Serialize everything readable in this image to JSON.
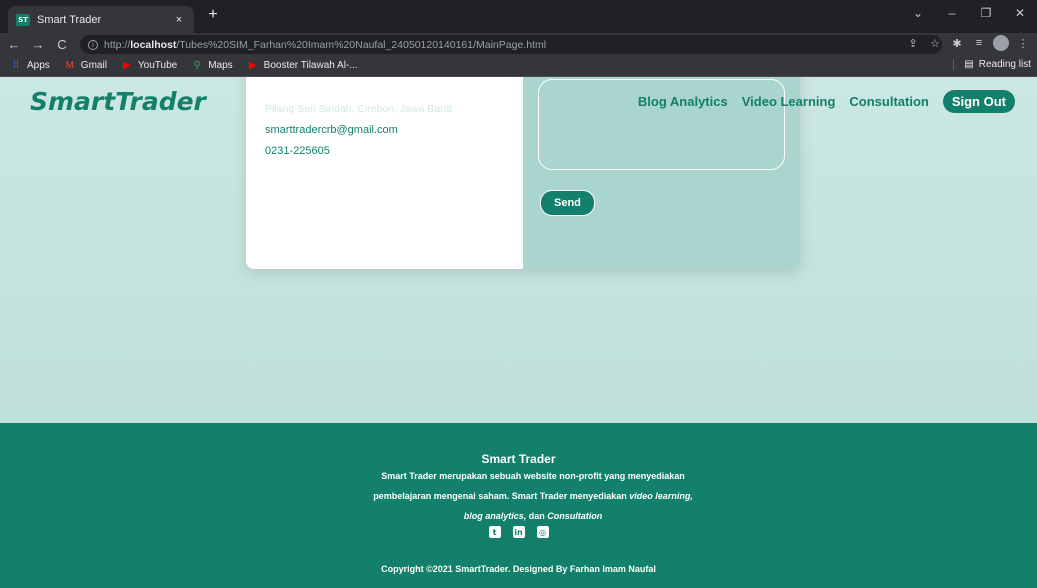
{
  "browser": {
    "tab": {
      "favicon": "ST",
      "title": "Smart Trader",
      "close": "×"
    },
    "new_tab": "+",
    "window_controls": [
      "⌄",
      "–",
      "❐",
      "✕"
    ],
    "nav_buttons": [
      "←",
      "→",
      "C"
    ],
    "url": {
      "prefix": "http://",
      "host": "localhost",
      "path": "/Tubes%20SIM_Farhan%20Imam%20Naufal_24050120140161/MainPage.html"
    },
    "toolbar_icons": [
      "⇪",
      "☆",
      "✱",
      "≡"
    ],
    "bookmarks": [
      {
        "icon": "apps-grid-icon",
        "glyph": "⁞⁞",
        "label": "Apps",
        "color": "#4285f4"
      },
      {
        "icon": "gmail-icon",
        "glyph": "M",
        "label": "Gmail",
        "color": "#ea4335"
      },
      {
        "icon": "youtube-icon",
        "glyph": "▶",
        "label": "YouTube",
        "color": "#ff0000"
      },
      {
        "icon": "maps-icon",
        "glyph": "⚲",
        "label": "Maps",
        "color": "#34a853"
      },
      {
        "icon": "youtube-icon",
        "glyph": "▶",
        "label": "Booster Tilawah Al-...",
        "color": "#ff0000"
      }
    ],
    "reading_list": "Reading list"
  },
  "header": {
    "logo": "SmartTrader",
    "nav": [
      "Blog Analytics",
      "Video Learning",
      "Consultation"
    ],
    "signout": "Sign Out"
  },
  "contact": {
    "address": "Pilang Sari Sindah, Cirebon, Jawa Barat",
    "email": "smarttradercrb@gmail.com",
    "phone": "0231-225605",
    "send": "Send"
  },
  "footer": {
    "title": "Smart Trader",
    "desc_pre": "Smart Trader merupakan sebuah website non-profit yang menyediakan pembelajaran mengenai saham. Smart Trader menyediakan ",
    "desc_em1": "video learning, blog analytics,",
    "desc_mid": " dan ",
    "desc_em2": "Consultation",
    "socials": [
      {
        "icon": "twitter-icon",
        "glyph": "t"
      },
      {
        "icon": "linkedin-icon",
        "glyph": "in"
      },
      {
        "icon": "instagram-icon",
        "glyph": "◎"
      }
    ],
    "copyright": "Copyright ©2021 SmartTrader. Designed By Farhan Imam Naufal"
  },
  "colors": {
    "brand": "#12806a",
    "page_bg": "#c9e6e1",
    "panel": "#a9d5ce"
  }
}
